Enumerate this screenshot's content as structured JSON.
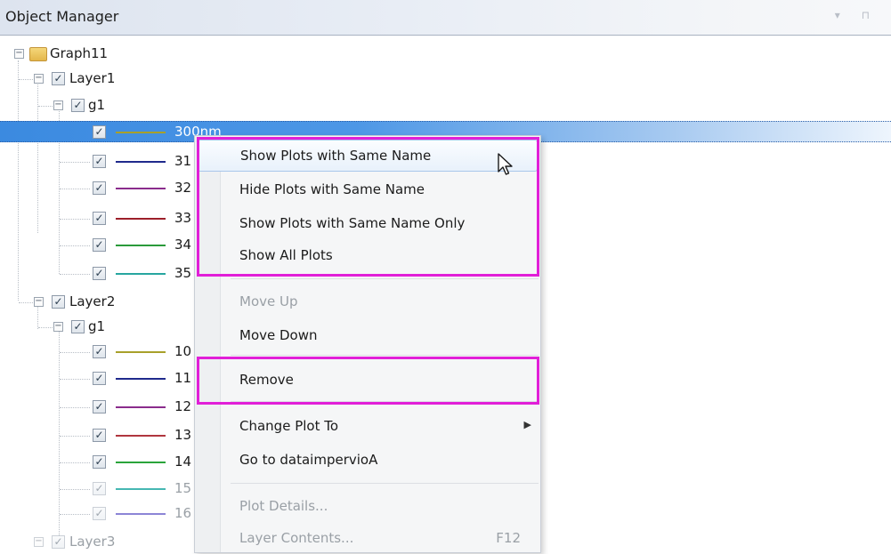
{
  "panel": {
    "title": "Object Manager",
    "pin_icons": "▾ ⊓"
  },
  "tree": {
    "root": {
      "label": "Graph11",
      "expander": "−"
    },
    "layer1": {
      "label": "Layer1",
      "check": "✓",
      "expander": "−"
    },
    "layer1_group": {
      "label": "g1",
      "check": "✓",
      "expander": "−"
    },
    "layer1_plots": [
      {
        "label": "300nm",
        "color": "#a8a02a",
        "check": "✓"
      },
      {
        "label": "31",
        "color": "#1f2a8c",
        "check": "✓"
      },
      {
        "label": "32",
        "color": "#8a2c8c",
        "check": "✓"
      },
      {
        "label": "33",
        "color": "#9c1f2a",
        "check": "✓"
      },
      {
        "label": "34",
        "color": "#2a9a3a",
        "check": "✓"
      },
      {
        "label": "35",
        "color": "#27a6a0",
        "check": "✓"
      }
    ],
    "layer2": {
      "label": "Layer2",
      "check": "✓",
      "expander": "−"
    },
    "layer2_group": {
      "label": "g1",
      "check": "✓",
      "expander": "−"
    },
    "layer2_plots": [
      {
        "label": "10",
        "color": "#a8a02a",
        "check": "✓"
      },
      {
        "label": "11",
        "color": "#1f2a8c",
        "check": "✓"
      },
      {
        "label": "12",
        "color": "#8a2c8c",
        "check": "✓"
      },
      {
        "label": "13",
        "color": "#b0363e",
        "check": "✓"
      },
      {
        "label": "14",
        "color": "#2aa43a",
        "check": "✓"
      },
      {
        "label": "15",
        "color": "#46b7b2",
        "check": "✓"
      },
      {
        "label": "16",
        "color": "#8c85d6",
        "check": "✓"
      }
    ],
    "layer3": {
      "label": "Layer3",
      "check": "✓",
      "expander": "−"
    }
  },
  "context_menu": {
    "items": [
      {
        "label": "Show Plots with Same Name"
      },
      {
        "label": "Hide Plots with Same Name"
      },
      {
        "label": "Show Plots with Same Name Only"
      },
      {
        "label": "Show All Plots"
      },
      {
        "label": "Move Up"
      },
      {
        "label": "Move Down"
      },
      {
        "label": "Remove"
      },
      {
        "label": "Change Plot To",
        "submenu_arrow": "▶"
      },
      {
        "label": "Go to dataimpervioA"
      },
      {
        "label": "Plot Details..."
      },
      {
        "label": "Layer Contents...",
        "shortcut": "F12"
      }
    ]
  },
  "highlight_color": "#e11fd8"
}
